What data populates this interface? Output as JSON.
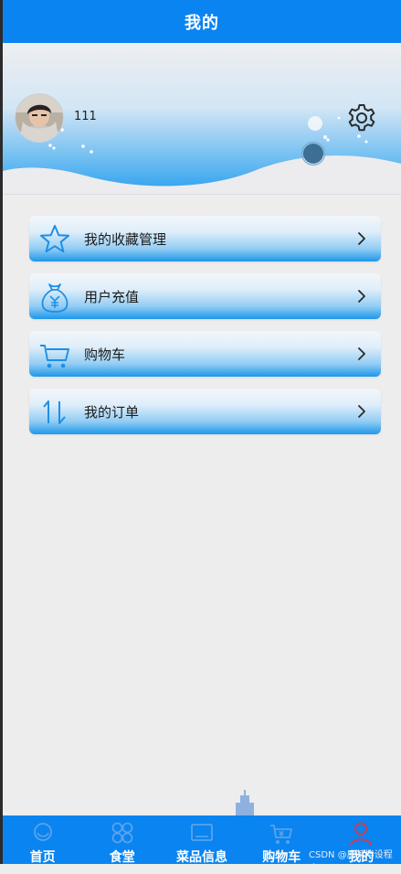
{
  "header": {
    "title": "我的"
  },
  "profile": {
    "username": "111",
    "avatar_icon": "user-avatar-photo",
    "settings_icon": "gear-icon"
  },
  "menu": [
    {
      "label": "我的收藏管理",
      "icon": "star-icon"
    },
    {
      "label": "用户充值",
      "icon": "money-bag-icon"
    },
    {
      "label": "购物车",
      "icon": "shopping-cart-icon"
    },
    {
      "label": "我的订单",
      "icon": "sort-arrows-icon"
    }
  ],
  "tabbar": [
    {
      "label": "首页",
      "icon": "home-icon"
    },
    {
      "label": "食堂",
      "icon": "grid-icon"
    },
    {
      "label": "菜品信息",
      "icon": "screen-icon"
    },
    {
      "label": "购物车",
      "icon": "cart-icon"
    },
    {
      "label": "我的",
      "icon": "person-icon"
    }
  ],
  "watermark": "CSDN @唐某毕设程序",
  "colors": {
    "primary": "#0a84f0",
    "background": "#ededee",
    "menu_bottom": "#1d97ea",
    "tab_icon_inactive": "#5ba3ea",
    "tab_icon_active": "#d33a4a"
  }
}
